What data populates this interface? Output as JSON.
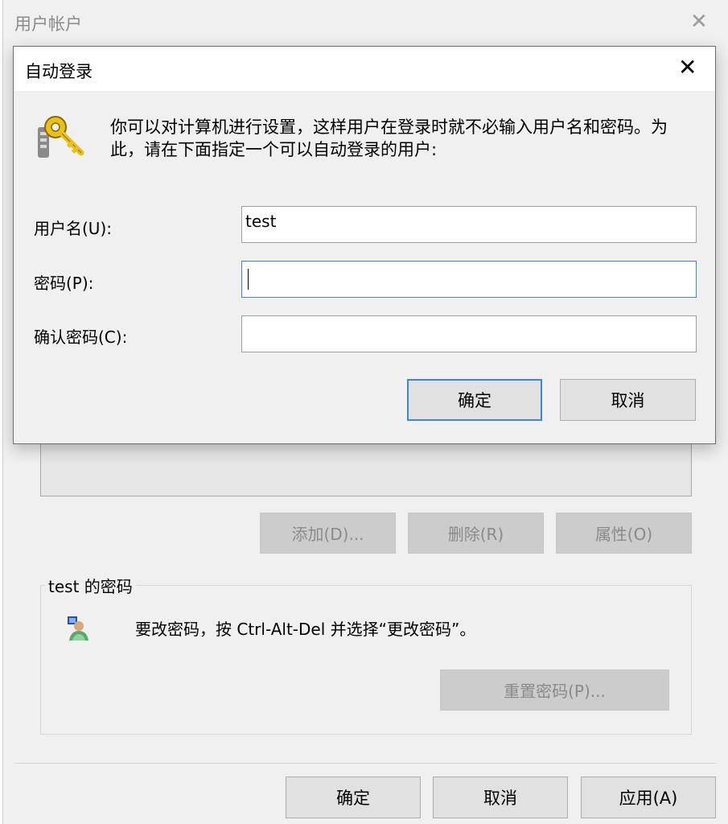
{
  "background_window": {
    "title": "用户帐户",
    "close_glyph": "✕",
    "buttons": {
      "add": "添加(D)...",
      "delete": "删除(R)",
      "properties": "属性(O)"
    },
    "password_group": {
      "title": "test 的密码",
      "icon": "user-key-icon",
      "message": "要改密码，按 Ctrl-Alt-Del 并选择“更改密码”。",
      "reset_button": "重置密码(P)..."
    },
    "footer": {
      "ok": "确定",
      "cancel": "取消",
      "apply": "应用(A)"
    }
  },
  "dialog": {
    "title": "自动登录",
    "close_glyph": "✕",
    "icon": "keys-icon",
    "description": "你可以对计算机进行设置，这样用户在登录时就不必输入用户名和密码。为此，请在下面指定一个可以自动登录的用户:",
    "fields": {
      "username_label": "用户名(U):",
      "username_value": "test",
      "password_label": "密码(P):",
      "password_value": "",
      "confirm_label": "确认密码(C):",
      "confirm_value": ""
    },
    "buttons": {
      "ok": "确定",
      "cancel": "取消"
    }
  }
}
